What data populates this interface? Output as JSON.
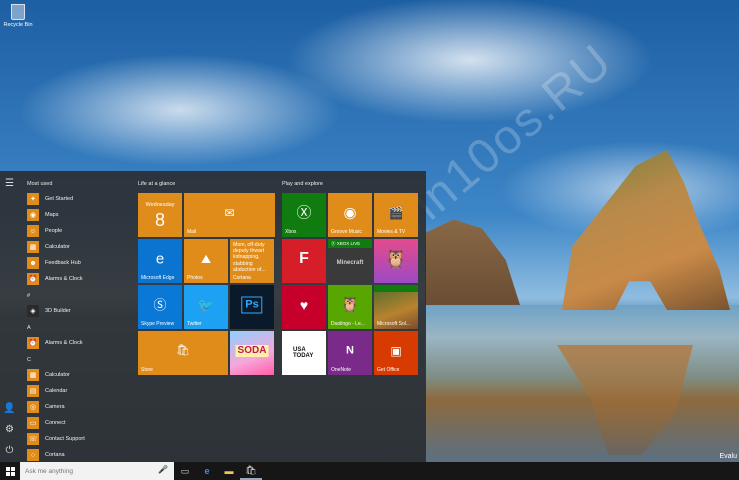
{
  "desktop": {
    "recycle_bin": "Recycle Bin",
    "watermark": "Win10os.RU",
    "eval_text": "Evalu"
  },
  "start_menu": {
    "most_used_header": "Most used",
    "most_used": [
      {
        "label": "Get Started",
        "icon": "lightbulb-icon"
      },
      {
        "label": "Maps",
        "icon": "maps-icon"
      },
      {
        "label": "People",
        "icon": "people-icon"
      },
      {
        "label": "Calculator",
        "icon": "calculator-icon"
      },
      {
        "label": "Feedback Hub",
        "icon": "feedback-icon"
      },
      {
        "label": "Alarms & Clock",
        "icon": "alarm-clock-icon"
      }
    ],
    "sections": [
      {
        "header": "#",
        "apps": [
          {
            "label": "3D Builder",
            "icon": "3d-builder-icon"
          }
        ]
      },
      {
        "header": "A",
        "apps": [
          {
            "label": "Alarms & Clock",
            "icon": "alarm-clock-icon"
          }
        ]
      },
      {
        "header": "C",
        "apps": [
          {
            "label": "Calculator",
            "icon": "calculator-icon"
          },
          {
            "label": "Calendar",
            "icon": "calendar-icon"
          },
          {
            "label": "Camera",
            "icon": "camera-icon"
          },
          {
            "label": "Connect",
            "icon": "connect-icon"
          },
          {
            "label": "Contact Support",
            "icon": "contact-support-icon"
          },
          {
            "label": "Cortana",
            "icon": "cortana-icon"
          }
        ]
      }
    ],
    "life_header": "Life at a glance",
    "play_header": "Play and explore",
    "tiles": {
      "calendar": {
        "day": "Wednesday",
        "date": "8"
      },
      "mail": "Mail",
      "edge": "Microsoft Edge",
      "photos": "Photos",
      "cortana": "Cortana",
      "cortana_news": "Mom, off-duty deputy thwart kidnapping, stabbing abduction of...",
      "skype": "Skype Preview",
      "twitter": "Twitter",
      "store": "Store",
      "xbox": "Xbox",
      "groove": "Groove Music",
      "movies": "Movies & TV",
      "usatoday": "USA TODAY",
      "onenote": "OneNote",
      "getoffice": "Get Office",
      "minecraft": "Minecraft",
      "duolingo": "Duolingo - Le...",
      "microsoft_sol": "Microsoft Sol...",
      "soda": "SODA"
    },
    "colors": {
      "accent": "#e08c1a",
      "edge_blue": "#0a74d0",
      "skype_blue": "#0a78d7",
      "twitter_blue": "#1da1f2",
      "xbox_green": "#107c10",
      "flipboard_red": "#d51e27",
      "iheart_red": "#c6002b",
      "duolingo_green": "#58a700",
      "onenote_purple": "#7a2b8a",
      "office_orange": "#d83b01"
    }
  },
  "taskbar": {
    "search_placeholder": "Ask me anything"
  }
}
